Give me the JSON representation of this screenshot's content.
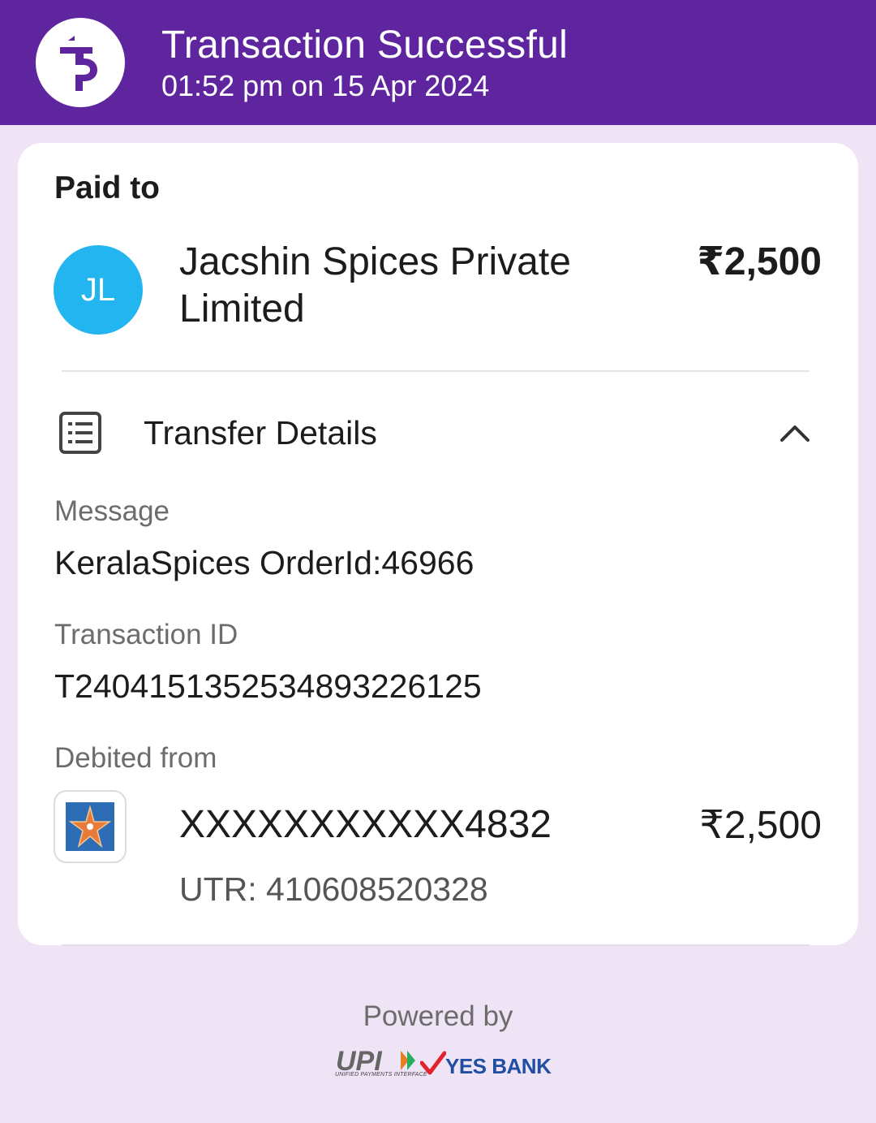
{
  "header": {
    "title": "Transaction Successful",
    "timestamp": "01:52 pm on 15 Apr 2024",
    "logo_icon": "phonepe-logo-icon",
    "background_color": "#5f259f"
  },
  "payment": {
    "section_label": "Paid to",
    "payee_initials": "JL",
    "payee_name": "Jacshin Spices Private Limited",
    "amount": "₹2,500",
    "avatar_color": "#23b5f0"
  },
  "transfer_details": {
    "title": "Transfer Details",
    "icon": "receipt-list-icon",
    "toggle_icon": "chevron-up-icon",
    "message_label": "Message",
    "message_value": "KeralaSpices OrderId:46966",
    "transaction_id_label": "Transaction ID",
    "transaction_id_value": "T2404151352534893226125",
    "debited_from_label": "Debited from",
    "bank_icon": "bank-star-logo-icon",
    "account_number": "XXXXXXXXXXX4832",
    "debit_amount": "₹2,500",
    "utr": "UTR: 410608520328"
  },
  "footer": {
    "powered_by": "Powered by",
    "upi_logo_text": "UPI",
    "upi_subtitle": "UNIFIED PAYMENTS INTERFACE",
    "bank_partner": "YES BANK"
  }
}
